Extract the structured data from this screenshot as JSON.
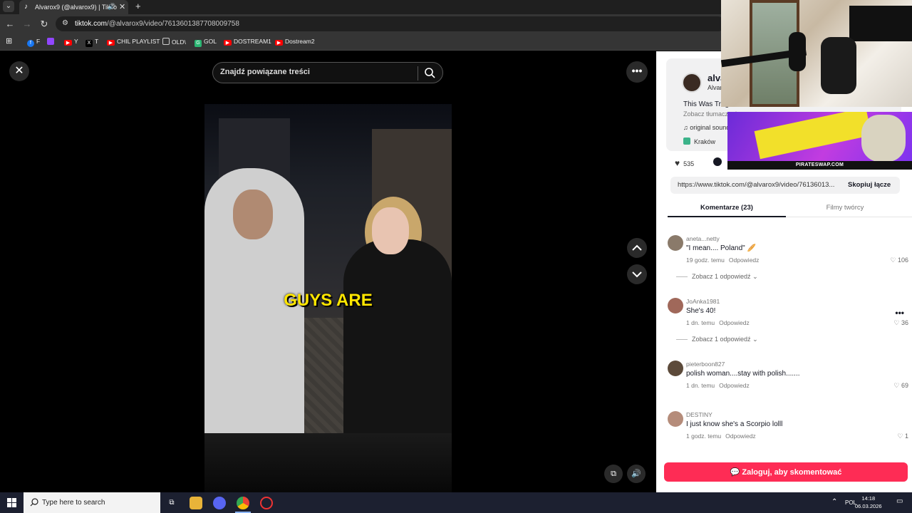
{
  "browser": {
    "tab_title": "Alvarox9 (@alvarox9) | TikTo",
    "url_host": "tiktok.com",
    "url_path": "/@alvarox9/video/7613601387708009758",
    "bookmarks": [
      {
        "label": "F",
        "color": "#1877f2"
      },
      {
        "label": "",
        "color": "#9146ff"
      },
      {
        "label": "Y",
        "color": "#ff0000"
      },
      {
        "label": "T",
        "color": "#000000"
      },
      {
        "label": "CHIL PLAYLIST",
        "color": "#ff0000"
      },
      {
        "label": "OLD\\",
        "color": "#555555"
      },
      {
        "label": "GOL",
        "color": "#2bb673"
      },
      {
        "label": "DOSTREAM1",
        "color": "#ff0000"
      },
      {
        "label": "Dostream2",
        "color": "#ff0000"
      }
    ]
  },
  "video": {
    "search_placeholder": "Znajdź powiązane treści",
    "caption": "GUYS ARE"
  },
  "panel": {
    "username": "alvaro",
    "handle": "Alvarox",
    "description": "This Was Trag",
    "translate": "Zobacz tłumaczenie",
    "sound": "original sound",
    "location": "Kraków",
    "likes": "535",
    "link": "https://www.tiktok.com/@alvarox9/video/76136013...",
    "copy_label": "Skopiuj łącze",
    "tab_comments": "Komentarze (23)",
    "tab_creator": "Filmy twórcy",
    "comments": [
      {
        "user": "aneta...netty",
        "text": "\"I mean.... Poland\" 🥖",
        "time": "19 godz. temu",
        "reply": "Odpowiedz",
        "likes": "106",
        "replies": "Zobacz 1 odpowiedź",
        "avatar": "#8a7a6a"
      },
      {
        "user": "JoAnka1981",
        "text": "She's 40!",
        "time": "1 dn. temu",
        "reply": "Odpowiedz",
        "likes": "36",
        "replies": "Zobacz 1 odpowiedź",
        "avatar": "#a0685a"
      },
      {
        "user": "pieterboon827",
        "text": "polish woman....stay with polish.......",
        "time": "1 dn. temu",
        "reply": "Odpowiedz",
        "likes": "69",
        "replies": "",
        "avatar": "#5c4a3a"
      },
      {
        "user": "DESTINY",
        "text": "I just know she's a Scorpio lolll",
        "time": "1 godz. temu",
        "reply": "Odpowiedz",
        "likes": "1",
        "replies": "",
        "avatar": "#b58c7a"
      }
    ],
    "login_label": "Zaloguj, aby skomentować"
  },
  "ad": {
    "brand": "PIRATESWAP.COM"
  },
  "taskbar": {
    "search_placeholder": "Type here to search",
    "lang": "POL",
    "time": "14:18",
    "date": "06.03.2026"
  }
}
